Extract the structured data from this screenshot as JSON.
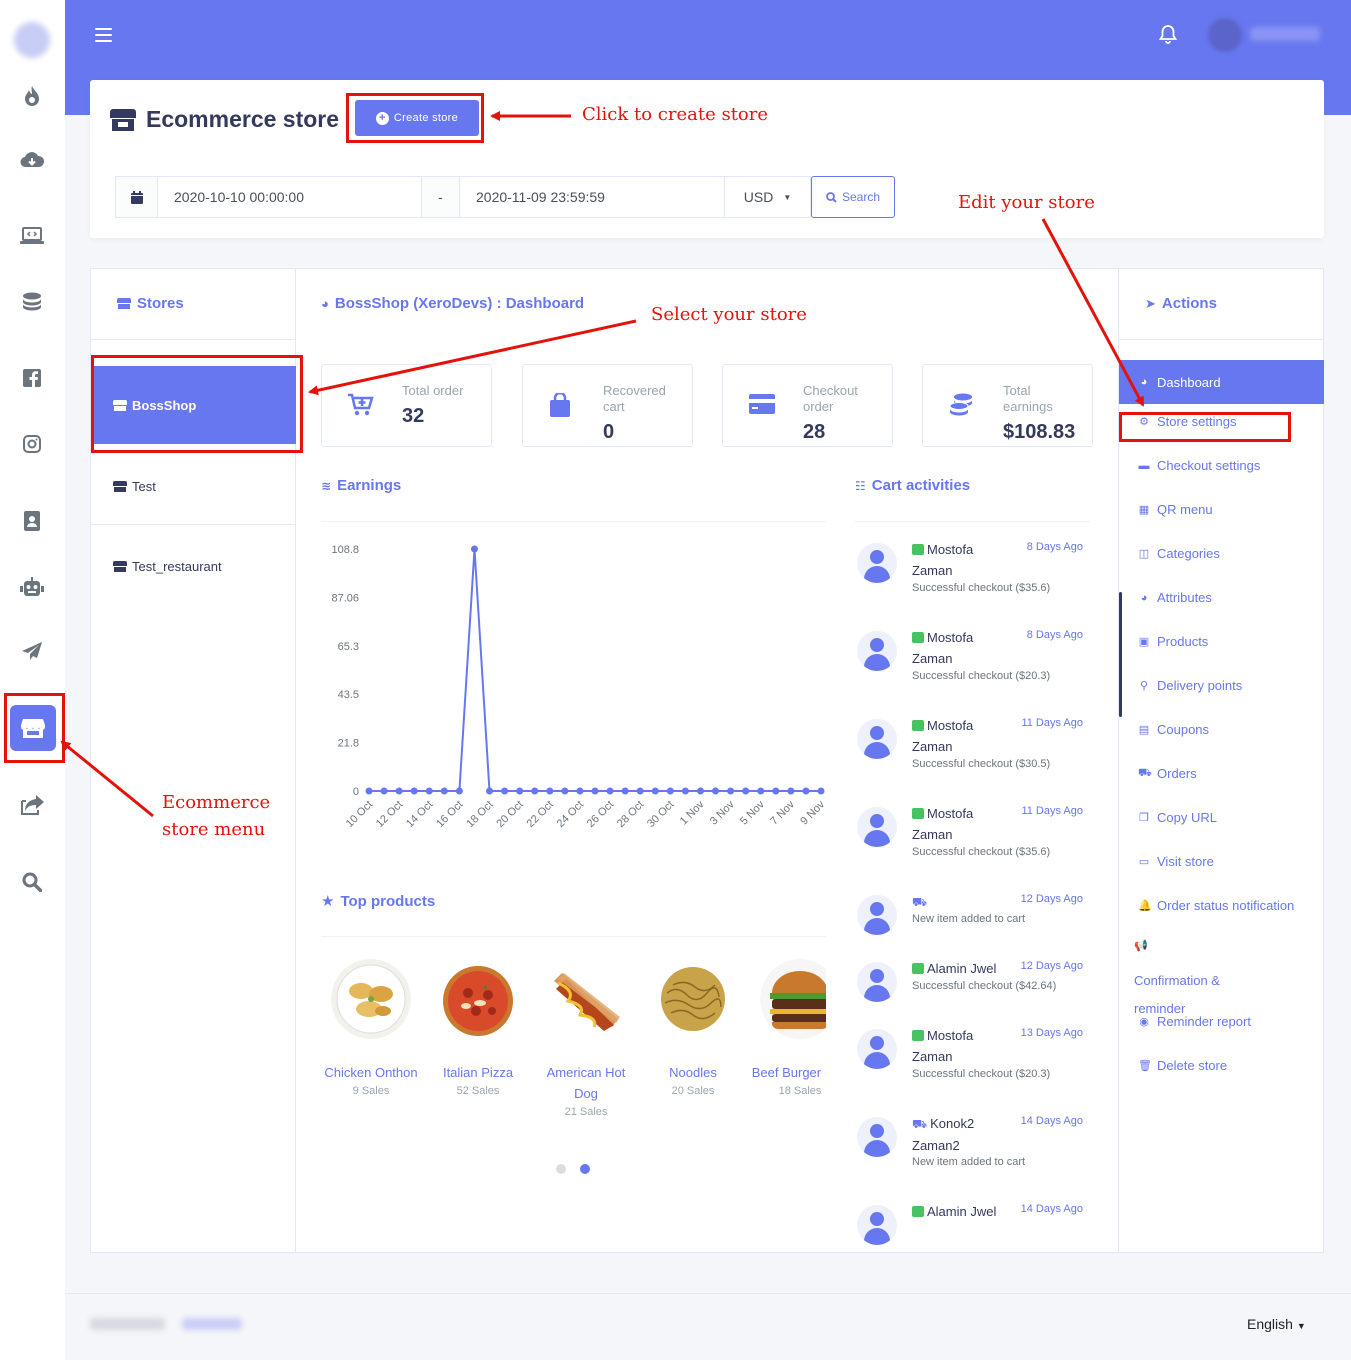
{
  "sidebar": {
    "items": [
      {
        "icon": "fire-icon",
        "glyph": "🔥"
      },
      {
        "icon": "cloud-download-icon",
        "glyph": "☁"
      },
      {
        "icon": "laptop-code-icon",
        "glyph": "💻"
      },
      {
        "icon": "coins-icon",
        "glyph": "🪙"
      },
      {
        "icon": "facebook-icon",
        "glyph": "f"
      },
      {
        "icon": "instagram-icon",
        "glyph": "◎"
      },
      {
        "icon": "address-book-icon",
        "glyph": "👤"
      },
      {
        "icon": "robot-icon",
        "glyph": "🤖"
      },
      {
        "icon": "paper-plane-icon",
        "glyph": "➤"
      },
      {
        "icon": "store-icon",
        "glyph": "🏪"
      },
      {
        "icon": "share-icon",
        "glyph": "↗"
      },
      {
        "icon": "search-icon",
        "glyph": "🔍"
      }
    ]
  },
  "header": {
    "page_title": "Ecommerce store",
    "create_store_label": "Create store"
  },
  "filters": {
    "date_from": "2020-10-10 00:00:00",
    "separator": "-",
    "date_to": "2020-11-09 23:59:59",
    "currency": "USD",
    "search_label": "Search"
  },
  "stores": {
    "heading": "Stores",
    "items": [
      "BossShop",
      "Test",
      "Test_restaurant"
    ],
    "selected": "BossShop"
  },
  "dashboard": {
    "heading": "BossShop (XeroDevs) : Dashboard",
    "stats": [
      {
        "label": "Total order",
        "value": "32",
        "icon": "cart-plus-icon"
      },
      {
        "label": "Recovered cart",
        "value": "0",
        "icon": "shopping-bag-icon"
      },
      {
        "label": "Checkout order",
        "value": "28",
        "icon": "credit-card-icon"
      },
      {
        "label": "Total earnings",
        "value": "$108.83",
        "icon": "coins-icon"
      }
    ],
    "earnings_heading": "Earnings",
    "cart_heading": "Cart activities",
    "top_products_heading": "Top products"
  },
  "chart_data": {
    "type": "line",
    "x": [
      "10 Oct",
      "11 Oct",
      "12 Oct",
      "13 Oct",
      "14 Oct",
      "15 Oct",
      "16 Oct",
      "17 Oct",
      "18 Oct",
      "19 Oct",
      "20 Oct",
      "21 Oct",
      "22 Oct",
      "23 Oct",
      "24 Oct",
      "25 Oct",
      "26 Oct",
      "27 Oct",
      "28 Oct",
      "29 Oct",
      "30 Oct",
      "31 Oct",
      "1 Nov",
      "2 Nov",
      "3 Nov",
      "4 Nov",
      "5 Nov",
      "6 Nov",
      "7 Nov",
      "8 Nov",
      "9 Nov"
    ],
    "tick_labels": [
      "10 Oct",
      "12 Oct",
      "14 Oct",
      "16 Oct",
      "18 Oct",
      "20 Oct",
      "22 Oct",
      "24 Oct",
      "26 Oct",
      "28 Oct",
      "30 Oct",
      "1 Nov",
      "3 Nov",
      "5 Nov",
      "7 Nov",
      "9 Nov"
    ],
    "series": [
      {
        "values": [
          0,
          0,
          0,
          0,
          0,
          0,
          0,
          108.8,
          0,
          0,
          0,
          0,
          0,
          0,
          0,
          0,
          0,
          0,
          0,
          0,
          0,
          0,
          0,
          0,
          0,
          0,
          0,
          0,
          0,
          0,
          0
        ]
      }
    ],
    "yticks": [
      "108.8",
      "87.06",
      "65.3",
      "43.5",
      "21.8",
      "0"
    ],
    "ylim": [
      0,
      108.8
    ],
    "color": "#6777ef"
  },
  "cart_activities": [
    {
      "name": "Mostofa Zaman",
      "kind": "checkout",
      "time": "8 Days Ago",
      "desc": "Successful checkout ($35.6)"
    },
    {
      "name": "Mostofa Zaman",
      "kind": "checkout",
      "time": "8 Days Ago",
      "desc": "Successful checkout ($20.3)"
    },
    {
      "name": "Mostofa Zaman",
      "kind": "checkout",
      "time": "11 Days Ago",
      "desc": "Successful checkout ($30.5)"
    },
    {
      "name": "Mostofa Zaman",
      "kind": "checkout",
      "time": "11 Days Ago",
      "desc": "Successful checkout ($35.6)"
    },
    {
      "name": "",
      "kind": "cart",
      "time": "12 Days Ago",
      "desc": "New item added to cart"
    },
    {
      "name": "Alamin Jwel",
      "kind": "checkout",
      "time": "12 Days Ago",
      "desc": "Successful checkout ($42.64)"
    },
    {
      "name": "Mostofa Zaman",
      "kind": "checkout",
      "time": "13 Days Ago",
      "desc": "Successful checkout ($20.3)"
    },
    {
      "name": "Konok2 Zaman2",
      "kind": "cart",
      "time": "14 Days Ago",
      "desc": "New item added to cart"
    },
    {
      "name": "Alamin Jwel",
      "kind": "checkout",
      "time": "14 Days Ago",
      "desc": ""
    }
  ],
  "top_products": [
    {
      "name": "Chicken Onthon",
      "sales": "9 Sales"
    },
    {
      "name": "Italian Pizza",
      "sales": "52 Sales"
    },
    {
      "name": "American Hot Dog",
      "sales": "21 Sales"
    },
    {
      "name": "Noodles",
      "sales": "20 Sales"
    },
    {
      "name": "Beef Burger দেশী",
      "sales": "18 Sales"
    }
  ],
  "actions": {
    "heading": "Actions",
    "items": [
      {
        "label": "Dashboard",
        "icon": "palette-icon",
        "glyph": "◕"
      },
      {
        "label": "Store settings",
        "icon": "cog-icon",
        "glyph": "⚙"
      },
      {
        "label": "Checkout settings",
        "icon": "credit-card-icon",
        "glyph": "▬"
      },
      {
        "label": "QR menu",
        "icon": "qrcode-icon",
        "glyph": "▦"
      },
      {
        "label": "Categories",
        "icon": "columns-icon",
        "glyph": "◫"
      },
      {
        "label": "Attributes",
        "icon": "palette-icon",
        "glyph": "◕"
      },
      {
        "label": "Products",
        "icon": "boxes-icon",
        "glyph": "▣"
      },
      {
        "label": "Delivery points",
        "icon": "map-marker-icon",
        "glyph": "⚲"
      },
      {
        "label": "Coupons",
        "icon": "building-icon",
        "glyph": "▤"
      },
      {
        "label": "Orders",
        "icon": "cart-icon",
        "glyph": "⛟"
      },
      {
        "label": "Copy URL",
        "icon": "copy-icon",
        "glyph": "❐"
      },
      {
        "label": "Visit store",
        "icon": "browser-icon",
        "glyph": "▭"
      },
      {
        "label": "Order status notification",
        "icon": "bell-icon",
        "glyph": "🔔"
      },
      {
        "label": "Confirmation & reminder",
        "icon": "bullhorn-icon",
        "glyph": "📢"
      },
      {
        "label": "Reminder report",
        "icon": "eye-icon",
        "glyph": "◉"
      },
      {
        "label": "Delete store",
        "icon": "trash-icon",
        "glyph": "🗑"
      }
    ]
  },
  "footer": {
    "language": "English"
  },
  "annotations": {
    "create": "Click to create store",
    "edit": "Edit your store",
    "select": "Select your store",
    "menu_line1": "Ecommerce",
    "menu_line2": "store menu"
  },
  "colors": {
    "primary": "#6777ef",
    "annotation": "#e3120b",
    "success": "#47c363"
  }
}
